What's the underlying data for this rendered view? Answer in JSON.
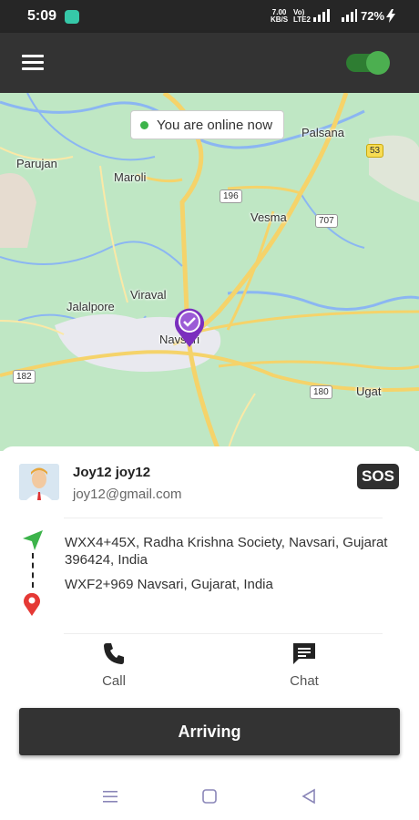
{
  "status_bar": {
    "time": "5:09",
    "speed_value": "7.00",
    "speed_unit": "KB/S",
    "volte_top": "Vo)",
    "volte_bottom": "LTE2",
    "battery": "72%",
    "icons": [
      "chat-app-icon",
      "wifi-signal-icon",
      "cell-signal-icon",
      "battery-charging-icon"
    ]
  },
  "toolbar": {
    "menu_icon": "hamburger-menu-icon",
    "online_toggle_on": true
  },
  "map": {
    "status_text": "You are online now",
    "places": [
      "Parujan",
      "Maroli",
      "Palsana",
      "Vesma",
      "Jalalpore",
      "Viraval",
      "Navsari",
      "Ugat"
    ],
    "route_shields": [
      "53",
      "196",
      "707",
      "182",
      "180"
    ],
    "marker_icon": "driver-location-pin-icon"
  },
  "rider": {
    "name": "Joy12 joy12",
    "email": "joy12@gmail.com",
    "sos_label": "SOS"
  },
  "trip": {
    "pickup": "WXX4+45X, Radha Krishna Society, Navsari, Gujarat 396424, India",
    "dropoff": "WXF2+969 Navsari, Gujarat, India"
  },
  "actions": {
    "call_label": "Call",
    "chat_label": "Chat"
  },
  "primary_button": "Arriving",
  "colors": {
    "toolbar": "#333333",
    "online_green": "#4caf50",
    "pickup_arrow": "#3cb34a",
    "dropoff_pin": "#e53935",
    "marker_purple": "#7b2fbe"
  }
}
